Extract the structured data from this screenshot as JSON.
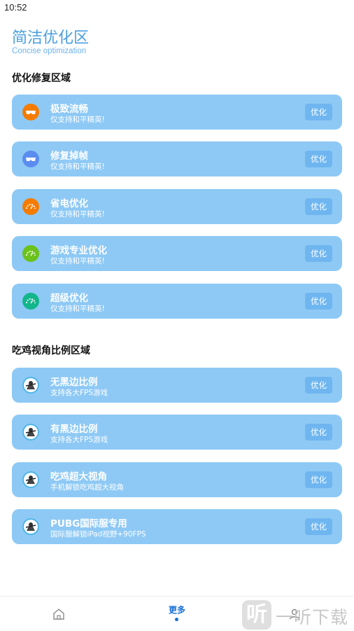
{
  "status_bar": {
    "time": "10:52"
  },
  "header": {
    "title": "简洁优化区",
    "subtitle": "Concise optimization"
  },
  "sections": [
    {
      "title": "优化修复区域",
      "items": [
        {
          "title": "极致流畅",
          "subtitle": "仅支持和平精英!",
          "button": "优化",
          "icon": "glasses-icon",
          "icon_color": "#f57c00"
        },
        {
          "title": "修复掉帧",
          "subtitle": "仅支持和平精英!",
          "button": "优化",
          "icon": "glasses-icon",
          "icon_color": "#5b8def"
        },
        {
          "title": "省电优化",
          "subtitle": "仅支持和平精英!",
          "button": "优化",
          "icon": "speedometer-icon",
          "icon_color": "#f57c00"
        },
        {
          "title": "游戏专业优化",
          "subtitle": "仅支持和平精英!",
          "button": "优化",
          "icon": "speedometer-icon",
          "icon_color": "#6cc21a"
        },
        {
          "title": "超级优化",
          "subtitle": "仅支持和平精英!",
          "button": "优化",
          "icon": "speedometer-icon",
          "icon_color": "#13b58b"
        }
      ]
    },
    {
      "title": "吃鸡视角比例区域",
      "items": [
        {
          "title": "无黑边比例",
          "subtitle": "支持各大FPS游戏",
          "button": "优化",
          "icon": "game-avatar-icon",
          "icon_color": "#4db6e8"
        },
        {
          "title": "有黑边比例",
          "subtitle": "支持各大FPS游戏",
          "button": "优化",
          "icon": "game-avatar-icon",
          "icon_color": "#4db6e8"
        },
        {
          "title": "吃鸡超大视角",
          "subtitle": "手机解锁吃鸡超大视角",
          "button": "优化",
          "icon": "game-avatar-icon",
          "icon_color": "#4db6e8"
        },
        {
          "title": "PUBG国际服专用",
          "subtitle": "国际服解锁iPad视野+90FPS",
          "button": "优化",
          "icon": "game-avatar-icon",
          "icon_color": "#4db6e8"
        }
      ]
    }
  ],
  "bottom_nav": {
    "items": [
      {
        "name": "home",
        "icon": "home-icon",
        "label": ""
      },
      {
        "name": "more",
        "icon": "",
        "label": "更多",
        "active": true
      },
      {
        "name": "third",
        "icon": "user-icon",
        "label": ""
      }
    ],
    "active_color": "#1a6fd6"
  },
  "watermark": {
    "glyph": "听",
    "text": "一听下载"
  },
  "colors": {
    "accent": "#4a9fe0",
    "card": "#8ec9f5",
    "button": "#6fb6f0"
  }
}
